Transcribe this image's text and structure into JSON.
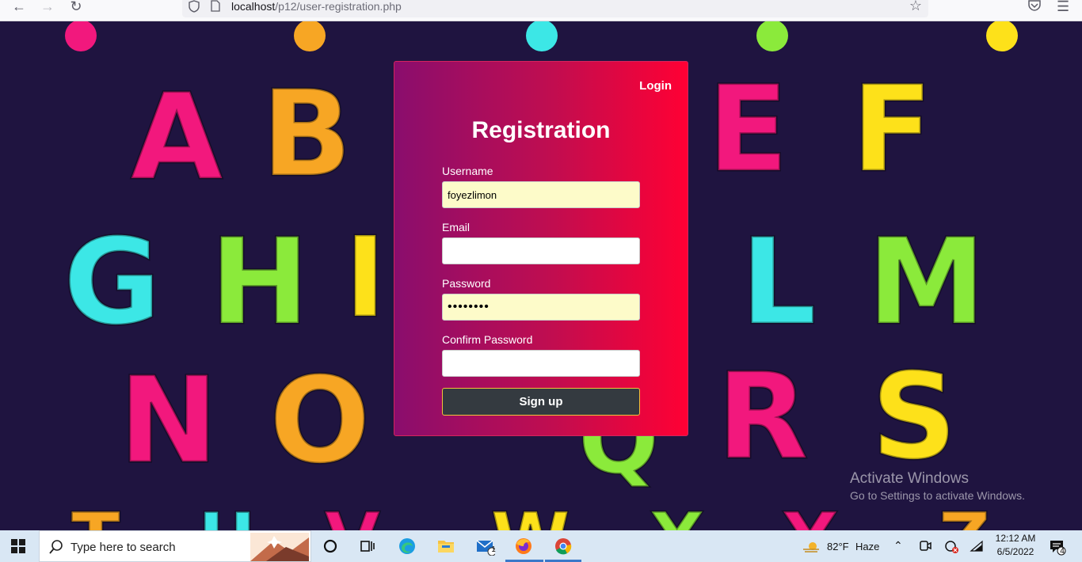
{
  "browser": {
    "url_host": "localhost",
    "url_path": "/p12/user-registration.php"
  },
  "background": {
    "letters": [
      "A",
      "B",
      "E",
      "F",
      "G",
      "H",
      "L",
      "M",
      "N",
      "O",
      "R",
      "S"
    ],
    "colors": {
      "bg": "#1f1440",
      "pink": "#f2187d",
      "orange": "#f7a624",
      "cyan": "#3ce7e6",
      "green": "#8bea3b",
      "yellow": "#fde11a"
    }
  },
  "card": {
    "login_link": "Login",
    "title": "Registration",
    "fields": {
      "username": {
        "label": "Username",
        "value": "foyezlimon"
      },
      "email": {
        "label": "Email",
        "value": ""
      },
      "password": {
        "label": "Password",
        "value": "••••••••"
      },
      "confirm_password": {
        "label": "Confirm Password",
        "value": ""
      }
    },
    "submit_label": "Sign up"
  },
  "activate_windows": {
    "title": "Activate Windows",
    "subtitle": "Go to Settings to activate Windows."
  },
  "taskbar": {
    "search_placeholder": "Type here to search",
    "mail_badge": "1",
    "weather": {
      "temp": "82°F",
      "condition": "Haze"
    },
    "time": "12:12 AM",
    "date": "6/5/2022",
    "notification_count": "4"
  }
}
